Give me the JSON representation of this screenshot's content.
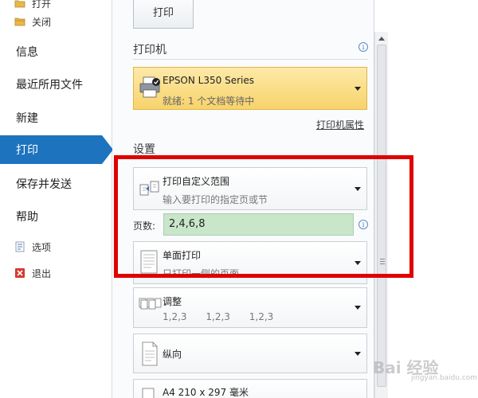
{
  "nav": {
    "open_label": "打开",
    "close_label": "关闭",
    "info_label": "信息",
    "recent_label": "最近所用文件",
    "new_label": "新建",
    "print_label": "打印",
    "save_send_label": "保存并发送",
    "help_label": "帮助",
    "options_label": "选项",
    "exit_label": "退出",
    "active_color": "#1e73be"
  },
  "print_button_label": "打印",
  "printer": {
    "section_title": "打印机",
    "name": "EPSON L350 Series",
    "status": "就绪: 1 个文档等待中",
    "properties_link": "打印机属性"
  },
  "settings": {
    "section_title": "设置",
    "range": {
      "title": "打印自定义范围",
      "subtitle": "输入要打印的指定页或节"
    },
    "pages_label": "页数:",
    "pages_value": "2,4,6,8",
    "sides": {
      "title": "单面打印",
      "subtitle": "只打印一侧的页面"
    },
    "collate": {
      "title": "调整",
      "values": [
        "1,2,3",
        "1,2,3",
        "1,2,3"
      ]
    },
    "orientation": {
      "title": "纵向"
    },
    "paper": {
      "title": "A4 210 x 297 毫米"
    }
  },
  "watermark": {
    "text": "Bai 经验",
    "sub": "jingyan.baidu.com"
  },
  "colors": {
    "highlight": "#e00000",
    "pages_field_bg": "#c9e6ca",
    "printer_bg": "#f7d36b"
  }
}
